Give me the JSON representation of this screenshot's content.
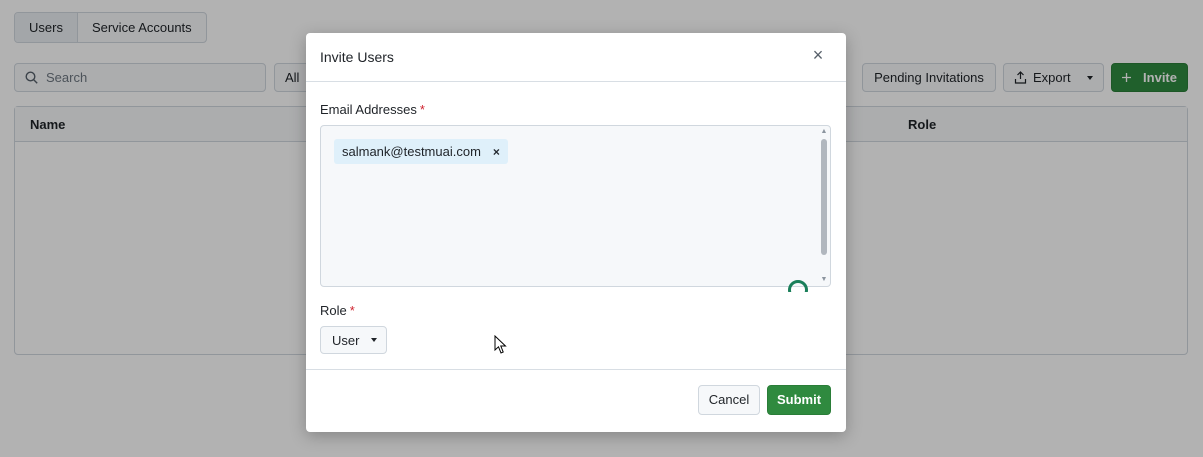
{
  "background": {
    "tabs": [
      {
        "label": "Users"
      },
      {
        "label": "Service Accounts"
      }
    ],
    "search_placeholder": "Search",
    "filter_label": "All",
    "pending_invitations_label": "Pending Invitations",
    "export_label": "Export",
    "invite_label": "Invite",
    "table_headers": {
      "name": "Name",
      "role": "Role"
    }
  },
  "modal": {
    "title": "Invite Users",
    "email_label": "Email Addresses",
    "required_mark": "*",
    "emails": [
      "salmank@testmuai.com"
    ],
    "tag_remove_glyph": "×",
    "role_label": "Role",
    "role_value": "User",
    "cancel_label": "Cancel",
    "submit_label": "Submit",
    "close_glyph": "×"
  },
  "colors": {
    "primary_green": "#2f8a3f",
    "required_red": "#cf222e",
    "tag_bg": "#dff0fa"
  },
  "icons": [
    "search-icon",
    "export-icon",
    "plus-icon",
    "close-icon",
    "chevron-down-icon",
    "assistant-icon",
    "mouse-pointer-icon"
  ]
}
